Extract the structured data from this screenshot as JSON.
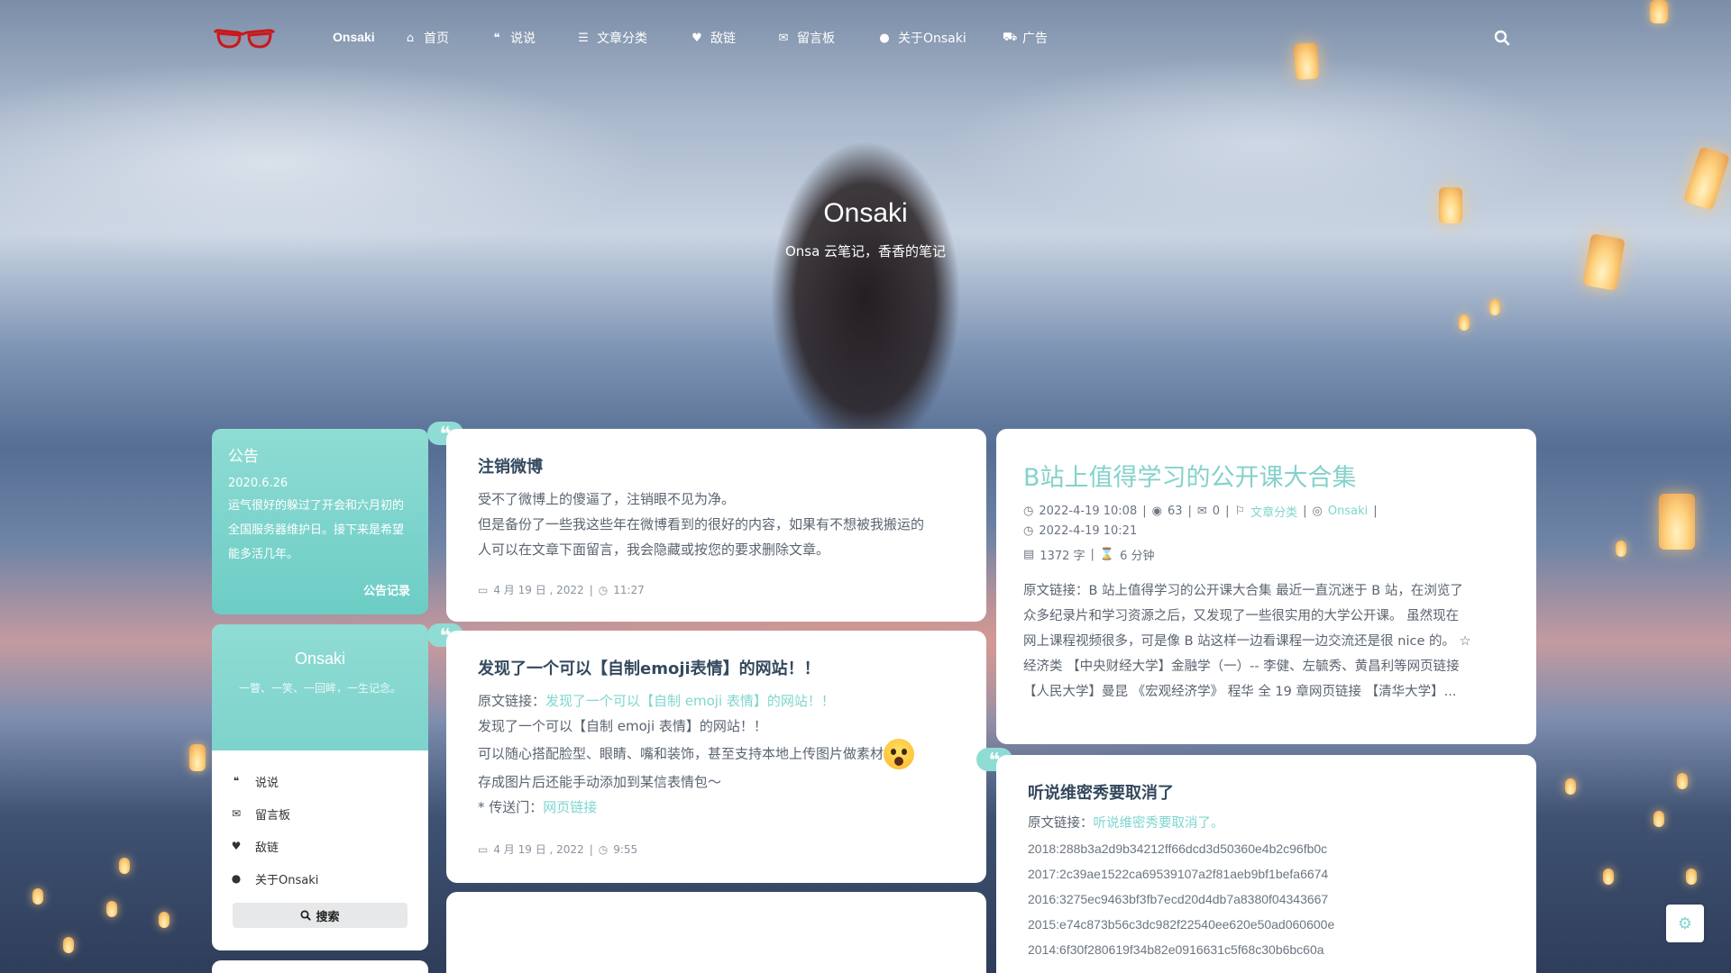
{
  "nav": {
    "brand": "Onsaki",
    "items": [
      {
        "icon": "home-icon",
        "glyph": "⌂",
        "label": "首页"
      },
      {
        "icon": "quote-icon",
        "glyph": "❝",
        "label": "说说"
      },
      {
        "icon": "list-icon",
        "glyph": "☰",
        "label": "文章分类"
      },
      {
        "icon": "heart-icon",
        "glyph": "♥",
        "label": "敌链"
      },
      {
        "icon": "comments-icon",
        "glyph": "✉",
        "label": "留言板"
      },
      {
        "icon": "user-icon",
        "glyph": "●",
        "label": "关于Onsaki"
      },
      {
        "icon": "cart-icon",
        "glyph": "⛟",
        "label": "广告"
      }
    ]
  },
  "hero": {
    "title": "Onsaki",
    "subtitle": "Onsa 云笔记，香香的笔记"
  },
  "notice": {
    "title": "公告",
    "date": "2020.6.26",
    "body": "运气很好的躲过了开会和六月初的全国服务器维护日。接下来是希望能多活几年。",
    "more": "公告记录"
  },
  "profile": {
    "name": "Onsaki",
    "motto": "一瞥、一笑、一回眸，一生记念。",
    "links": [
      {
        "icon": "quote-icon",
        "glyph": "❝",
        "label": "说说"
      },
      {
        "icon": "comment-icon",
        "glyph": "✉",
        "label": "留言板"
      },
      {
        "icon": "heart-icon",
        "glyph": "♥",
        "label": "敌链"
      },
      {
        "icon": "user-icon",
        "glyph": "●",
        "label": "关于Onsaki"
      }
    ],
    "search_label": "搜索"
  },
  "posts_left": [
    {
      "title": "注销微博",
      "lines": [
        "受不了微博上的傻逼了，注销眼不见为净。",
        "但是备份了一些我这些年在微博看到的很好的内容，如果有不想被我搬运的",
        "人可以在文章下面留言，我会隐藏或按您的要求删除文章。"
      ],
      "date": "4 月 19 日 , 2022",
      "time": "11:27"
    },
    {
      "title": "发现了一个可以【自制emoji表情】的网站！！",
      "source_label": "原文链接：",
      "source_link": "发现了一个可以【自制 emoji 表情】的网站！！",
      "lines": [
        "发现了一个可以【自制 emoji 表情】的网站！！",
        "可以随心搭配脸型、眼睛、嘴和装饰，甚至支持本地上传图片做素材",
        "存成图片后还能手动添加到某信表情包～"
      ],
      "portal_label": "* 传送门：",
      "portal_link": "网页链接",
      "date": "4 月 19 日 , 2022",
      "time": "9:55"
    }
  ],
  "feature_post": {
    "title": "B站上值得学习的公开课大合集",
    "created": "2022-4-19 10:08",
    "views": "63",
    "comments": "0",
    "category": "文章分类",
    "author": "Onsaki",
    "updated": "2022-4-19 10:21",
    "words": "1372 字",
    "read_time": "6 分钟",
    "excerpt_lines": [
      "原文链接：B 站上值得学习的公开课大合集 最近一直沉迷于 B 站，在浏览了",
      "众多纪录片和学习资源之后，又发现了一些很实用的大学公开课。 虽然现在",
      "网上课程视频很多，可是像 B 站这样一边看课程一边交流还是很 nice 的。 ☆",
      "经济类 【中央财经大学】金融学（一）-- 李健、左毓秀、黄昌利等网页链接",
      "【人民大学】曼昆 《宏观经济学》 程华 全 19 章网页链接 【清华大学】..."
    ]
  },
  "right_post": {
    "title": "听说维密秀要取消了",
    "source_label": "原文链接：",
    "source_link": "听说维密秀要取消了。",
    "hashes": [
      "2018:288b3a2d9b34212ff66dcd3d50360e4b2c96fb0c",
      "2017:2c39ae1522ca69539107a2f81aeb9bf1befa6674",
      "2016:3275ec9463bf3fb7ecd20d4db7a8380f04343667",
      "2015:e74c873b56c3dc982f22540ee620e50ad060600e",
      "2014:6f30f280619f34b82e0916631c5f68c30b6bc60a"
    ]
  },
  "colors": {
    "accent": "#7fd6cf",
    "title": "#34495e",
    "text": "#5b6470"
  }
}
